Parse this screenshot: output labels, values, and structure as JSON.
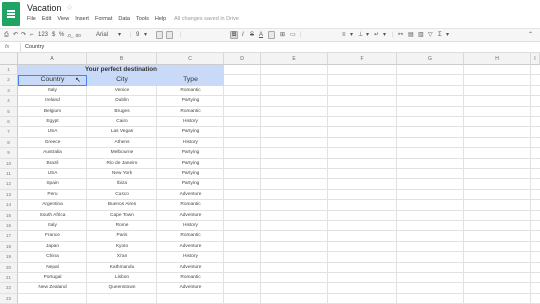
{
  "app": {
    "doc_title": "Vacation",
    "menu": [
      "File",
      "Edit",
      "View",
      "Insert",
      "Format",
      "Data",
      "Tools",
      "Help"
    ],
    "save_status": "All changes saved in Drive",
    "accent": "#1fa463"
  },
  "toolbar": {
    "zoom": "123",
    "font": "Arial",
    "font_size": "9",
    "currency": "$",
    "percent": "%",
    "decimals": ".0_ .00",
    "bold": "B",
    "italic": "I",
    "strike": "S",
    "text_color": "A",
    "sum": "Σ"
  },
  "formula_bar": {
    "label": "fx",
    "value": "Country"
  },
  "grid": {
    "columns": [
      "A",
      "B",
      "C",
      "D",
      "E",
      "F",
      "G",
      "H",
      "I"
    ],
    "rows": [
      "1",
      "2",
      "3",
      "4",
      "5",
      "6",
      "7",
      "8",
      "9",
      "10",
      "11",
      "12",
      "13",
      "14",
      "15",
      "16",
      "17",
      "18",
      "19",
      "20",
      "21",
      "22",
      "23"
    ],
    "title": "Your perfect destination",
    "headers": [
      "Country",
      "City",
      "Type"
    ],
    "header_fill": "#c9daf8",
    "data": [
      [
        "Italy",
        "Venice",
        "Romantic"
      ],
      [
        "Ireland",
        "Dublin",
        "Partying"
      ],
      [
        "Belgium",
        "Bruges",
        "Romantic"
      ],
      [
        "Egypt",
        "Cairo",
        "History"
      ],
      [
        "USA",
        "Las Vegas",
        "Partying"
      ],
      [
        "Greece",
        "Athens",
        "History"
      ],
      [
        "Australia",
        "Melbourne",
        "Partying"
      ],
      [
        "Brazil",
        "Rio de Janeiro",
        "Partying"
      ],
      [
        "USA",
        "New York",
        "Partying"
      ],
      [
        "Spain",
        "Ibiza",
        "Partying"
      ],
      [
        "Peru",
        "Cusco",
        "Adventure"
      ],
      [
        "Argentina",
        "Buenos Aires",
        "Romantic"
      ],
      [
        "South Africa",
        "Cape Town",
        "Adventure"
      ],
      [
        "Italy",
        "Rome",
        "History"
      ],
      [
        "France",
        "Paris",
        "Romantic"
      ],
      [
        "Japan",
        "Kyoto",
        "Adventure"
      ],
      [
        "China",
        "Xi'an",
        "History"
      ],
      [
        "Nepal",
        "Kathmandu",
        "Adventure"
      ],
      [
        "Portugal",
        "Lisbon",
        "Romantic"
      ],
      [
        "New Zealand",
        "Queenstown",
        "Adventure"
      ]
    ]
  }
}
